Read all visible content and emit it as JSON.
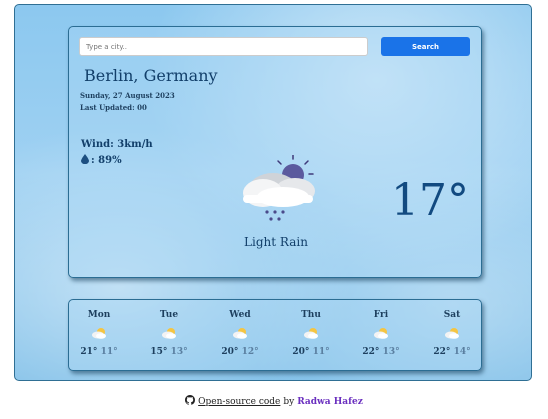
{
  "search": {
    "placeholder": "Type a city..",
    "button_label": "Search"
  },
  "current": {
    "city": "Berlin, Germany",
    "date": "Sunday, 27 August 2023",
    "last_updated": "Last Updated: 00",
    "wind": "Wind: 3km/h",
    "humidity": ": 89%",
    "condition": "Light Rain",
    "temperature": "17°",
    "icon": "cloud-rain-moon-icon"
  },
  "forecast": [
    {
      "day": "Mon",
      "max": "21°",
      "min": "11°",
      "icon": "partly-cloudy-icon"
    },
    {
      "day": "Tue",
      "max": "15°",
      "min": "13°",
      "icon": "partly-cloudy-icon"
    },
    {
      "day": "Wed",
      "max": "20°",
      "min": "12°",
      "icon": "partly-cloudy-icon"
    },
    {
      "day": "Thu",
      "max": "20°",
      "min": "11°",
      "icon": "partly-cloudy-icon"
    },
    {
      "day": "Fri",
      "max": "22°",
      "min": "13°",
      "icon": "partly-cloudy-icon"
    },
    {
      "day": "Sat",
      "max": "22°",
      "min": "14°",
      "icon": "partly-cloudy-icon"
    }
  ],
  "footer": {
    "link_text": "Open-source code",
    "by_text": "by",
    "author": "Radwa Hafez",
    "icon": "github-icon"
  },
  "colors": {
    "accent": "#1a73e8",
    "text_dark": "#123f6a",
    "author": "#6a2fbf"
  }
}
